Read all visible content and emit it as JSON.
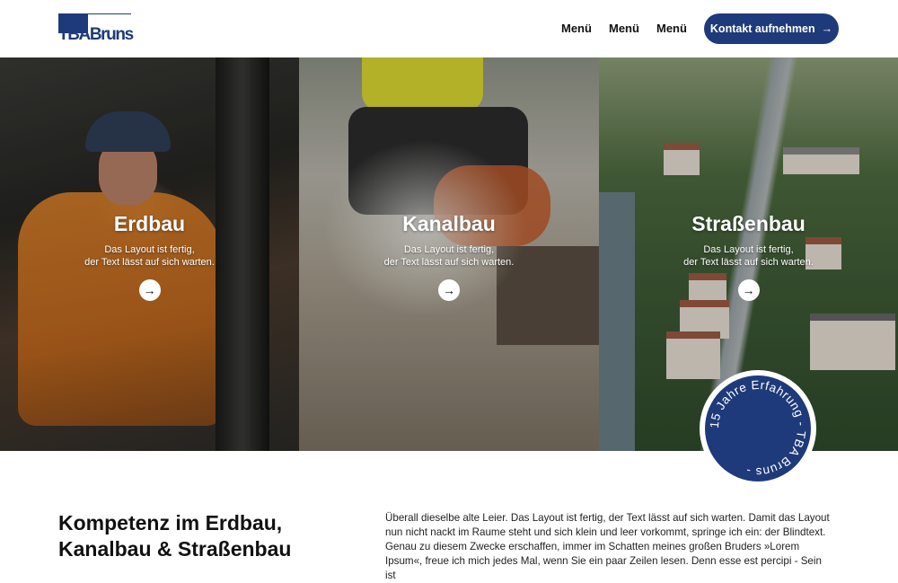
{
  "header": {
    "logo_text": "TBABruns",
    "nav": [
      "Menü",
      "Menü",
      "Menü"
    ],
    "cta_label": "Kontakt aufnehmen",
    "cta_icon": "arrow-right-icon"
  },
  "hero": {
    "panels": [
      {
        "title": "Erdbau",
        "line1": "Das Layout ist fertig,",
        "line2": "der Text lässt auf sich warten."
      },
      {
        "title": "Kanalbau",
        "line1": "Das Layout ist fertig,",
        "line2": "der Text lässt auf sich warten."
      },
      {
        "title": "Straßenbau",
        "line1": "Das Layout ist fertig,",
        "line2": "der Text lässt auf sich warten."
      }
    ],
    "arrow_icon": "arrow-right-icon"
  },
  "badge": {
    "text": "15 Jahre Erfahrung - TBA Bruns -"
  },
  "intro": {
    "heading": "Kompetenz im Erdbau, Kanalbau & Straßenbau",
    "body": "Überall dieselbe alte Leier. Das Layout ist fertig, der Text lässt auf sich warten. Damit das Layout nun nicht nackt im Raume steht und sich klein und leer vorkommt, springe ich ein: der Blindtext. Genau zu diesem Zwecke erschaffen, immer im Schatten meines großen Bruders »Lorem Ipsum«, freue ich mich jedes Mal, wenn Sie ein paar Zeilen lesen. Denn esse est percipi - Sein ist"
  },
  "colors": {
    "brand": "#1f3a7a",
    "white": "#ffffff"
  }
}
